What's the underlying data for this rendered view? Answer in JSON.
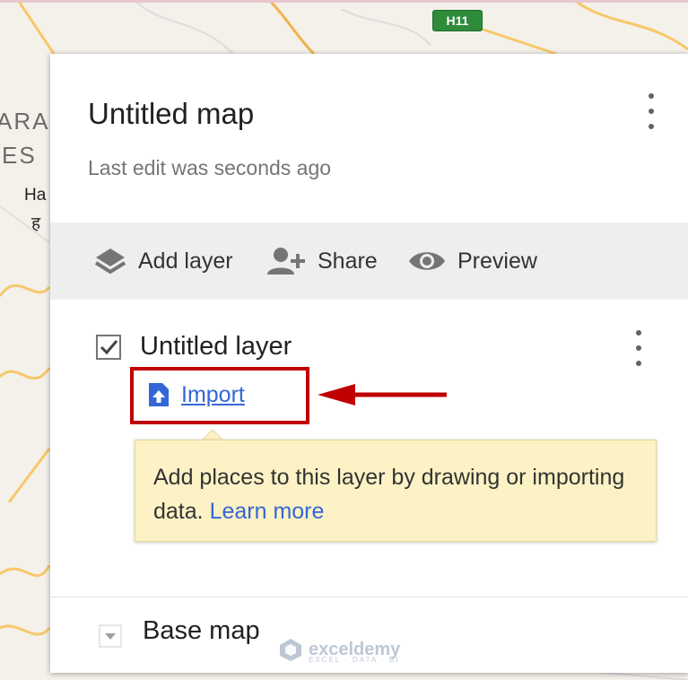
{
  "map": {
    "highway_shield": "H11",
    "labels": [
      "ARA",
      "ES",
      "Ha",
      "ह"
    ]
  },
  "panel": {
    "title": "Untitled map",
    "subtitle": "Last edit was seconds ago",
    "toolbar": {
      "add_layer_label": "Add layer",
      "share_label": "Share",
      "preview_label": "Preview"
    },
    "layer": {
      "name": "Untitled layer",
      "checked": true,
      "import_label": "Import"
    },
    "tooltip": {
      "text": "Add places to this layer by drawing or importing data.",
      "link": "Learn more"
    },
    "base_map_label": "Base map"
  },
  "watermark": {
    "name": "exceldemy",
    "tagline": "EXCEL · DATA · BI"
  },
  "icons": {
    "menu": "more-vert-icon",
    "add_layer": "layers-icon",
    "share": "person-add-icon",
    "preview": "eye-icon",
    "import": "file-upload-icon"
  },
  "colors": {
    "link": "#3367d6",
    "highlight": "#c00000",
    "tooltip_bg": "#fdf2c5",
    "toolbar_bg": "#eeeeee"
  }
}
